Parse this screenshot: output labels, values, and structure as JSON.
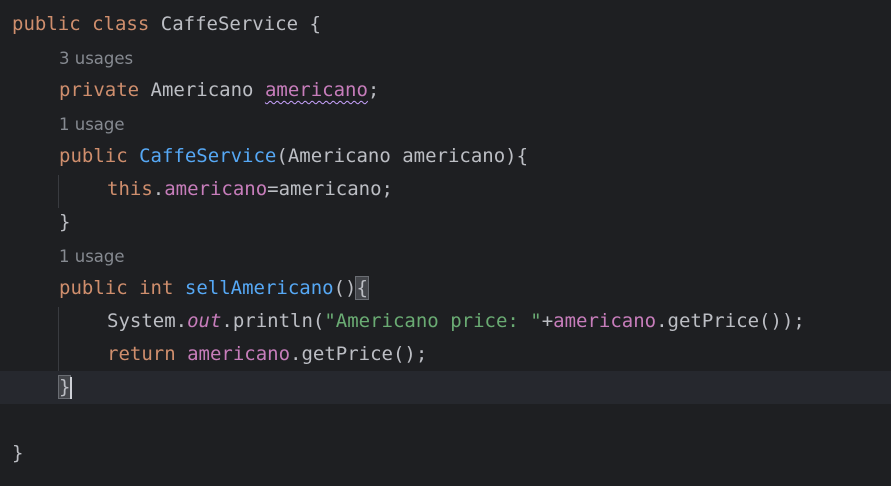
{
  "code": {
    "class_decl": {
      "kw_public": "public",
      "kw_class": "class",
      "class_name": "CaffeService",
      "open_brace": "{"
    },
    "hint_field": "3 usages",
    "field_decl": {
      "kw_private": "private",
      "type": "Americano",
      "name": "americano",
      "semi": ";"
    },
    "hint_ctor": "1 usage",
    "ctor_decl": {
      "kw_public": "public",
      "name": "CaffeService",
      "params_open": "(Americano americano){"
    },
    "ctor_body": {
      "kw_this": "this",
      "dot": ".",
      "field": "americano",
      "rest": "=americano;"
    },
    "ctor_close": "}",
    "hint_method": "1 usage",
    "method_decl": {
      "kw_public": "public",
      "kw_int": "int",
      "name": "sellAmericano",
      "parens": "()",
      "open_brace": "{"
    },
    "println_line": {
      "system": "System.",
      "out": "out",
      "println": ".println(",
      "string": "\"Americano price: \"",
      "plus": "+",
      "field": "americano",
      "rest": ".getPrice());"
    },
    "return_line": {
      "kw_return": "return",
      "field": "americano",
      "rest": ".getPrice();"
    },
    "method_close": "}",
    "class_close": "}"
  },
  "colors": {
    "background": "#1e1f22",
    "keyword": "#cf8e6d",
    "function": "#56a8f5",
    "field": "#c77dbb",
    "string": "#6aab73",
    "text": "#bcbec4",
    "hint": "#868a91"
  }
}
